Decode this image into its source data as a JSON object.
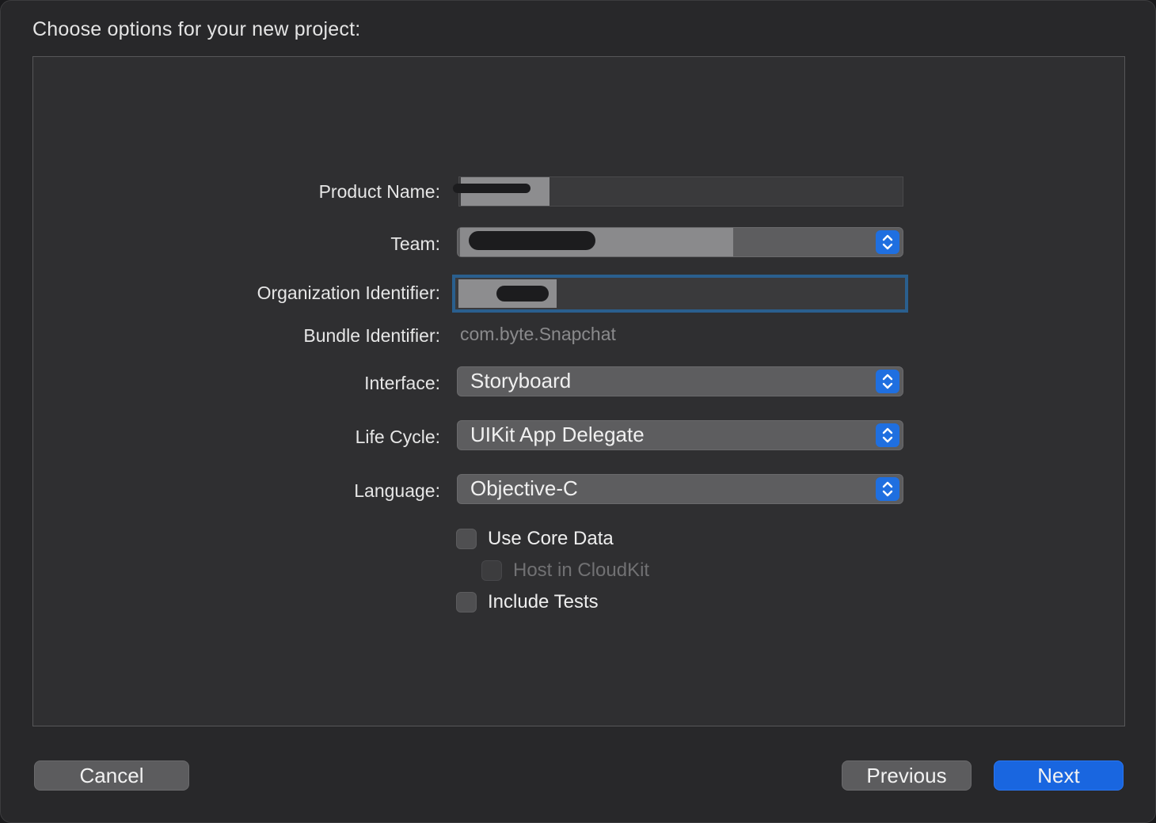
{
  "header": {
    "title": "Choose options for your new project:"
  },
  "form": {
    "product_name_label": "Product Name:",
    "team_label": "Team:",
    "org_id_label": "Organization Identifier:",
    "bundle_id_label": "Bundle Identifier:",
    "bundle_id_value": "com.byte.Snapchat",
    "interface_label": "Interface:",
    "interface_value": "Storyboard",
    "lifecycle_label": "Life Cycle:",
    "lifecycle_value": "UIKit App Delegate",
    "language_label": "Language:",
    "language_value": "Objective-C"
  },
  "options": {
    "use_core_data": "Use Core Data",
    "host_in_cloudkit": "Host in CloudKit",
    "include_tests": "Include Tests"
  },
  "buttons": {
    "cancel": "Cancel",
    "previous": "Previous",
    "next": "Next"
  },
  "colors": {
    "accent": "#1966e0",
    "focus_ring": "#2a5f8e"
  }
}
